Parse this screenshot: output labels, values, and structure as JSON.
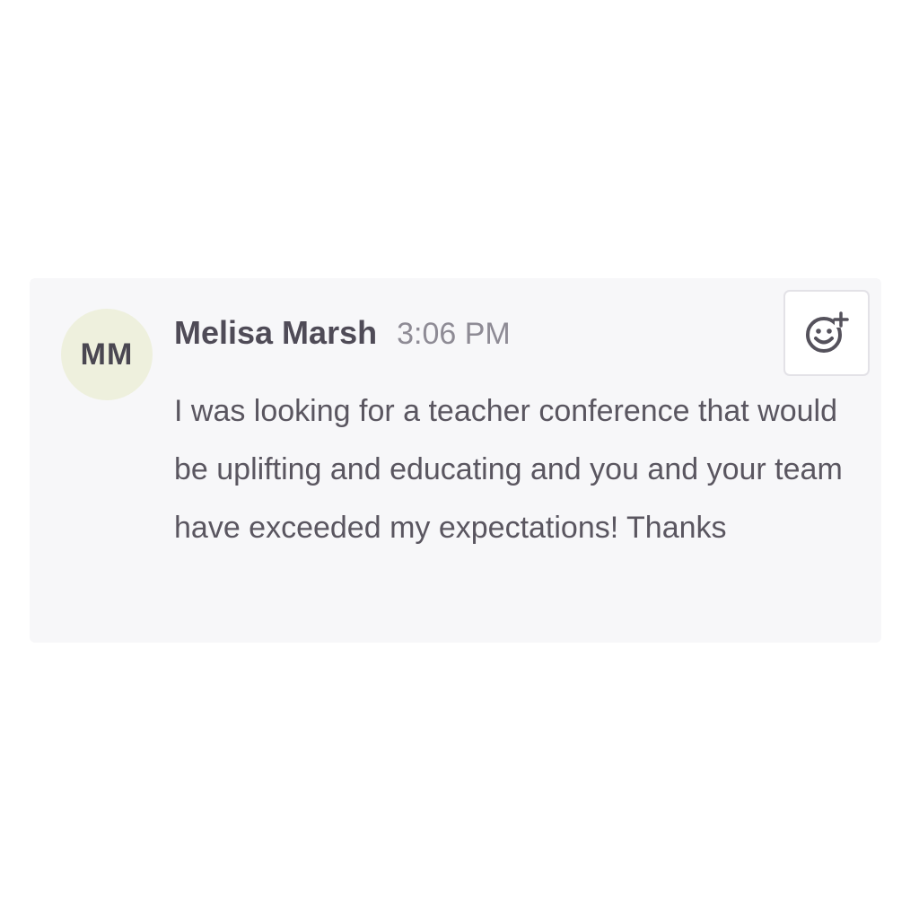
{
  "message": {
    "avatar_initials": "MM",
    "author": "Melisa Marsh",
    "timestamp": "3:06 PM",
    "body": "I was looking for a teacher conference that would be uplifting and educating and you and your team have exceeded my expectations! Thanks"
  },
  "actions": {
    "add_reaction_icon": "add-reaction-smiley"
  },
  "colors": {
    "card_background": "#f7f7f9",
    "avatar_background": "#eef0dd",
    "author_text": "#4f4b57",
    "timestamp_text": "#8e8b95",
    "body_text": "#5a5660"
  }
}
